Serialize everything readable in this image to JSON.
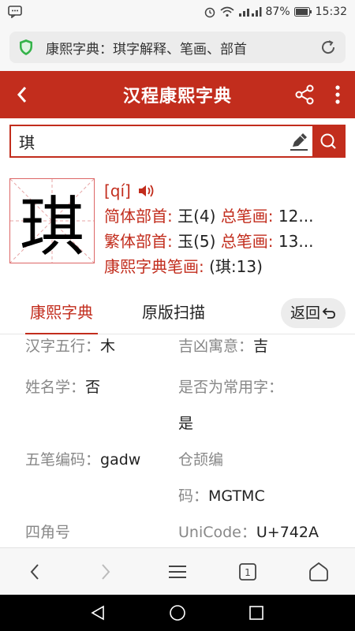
{
  "status_bar": {
    "battery": "87%",
    "time": "15:32"
  },
  "browser": {
    "url_text": "康熙字典：琪字解释、笔画、部首"
  },
  "header": {
    "title": "汉程康熙字典"
  },
  "search": {
    "value": "琪"
  },
  "character": {
    "glyph": "琪",
    "pinyin": "[qí]",
    "line1": {
      "label": "简体部首:",
      "value": "王(4)",
      "label2": "总笔画:",
      "value2": "12..."
    },
    "line2": {
      "label": "繁体部首:",
      "value": "玉(5)",
      "label2": "总笔画:",
      "value2": "13..."
    },
    "line3": {
      "label": "康熙字典笔画:",
      "value": "(琪:13)"
    }
  },
  "tabs": {
    "kangxi": "康熙字典",
    "scan": "原版扫描",
    "return": "返回"
  },
  "details": {
    "wuxing_label": "汉字五行：",
    "wuxing_value": "木",
    "jixiong_label": "吉凶寓意：",
    "jixiong_value": "吉",
    "xingming_label": "姓名学：",
    "xingming_value": "否",
    "changyong_label": "是否为常用字：",
    "changyong_value": "是",
    "wubi_label": "五笔编码：",
    "wubi_value": "gadw",
    "cangjie_label_1": "仓颉编",
    "cangjie_label_2": "码：",
    "cangjie_value": "MGTMC",
    "sijiao_label": "四角号",
    "unicode_label": "UniCode：",
    "unicode_value": "U+742A"
  },
  "browser_nav": {
    "tab_count": "1"
  },
  "colors": {
    "brand": "#c22d1d",
    "muted": "#888888"
  }
}
